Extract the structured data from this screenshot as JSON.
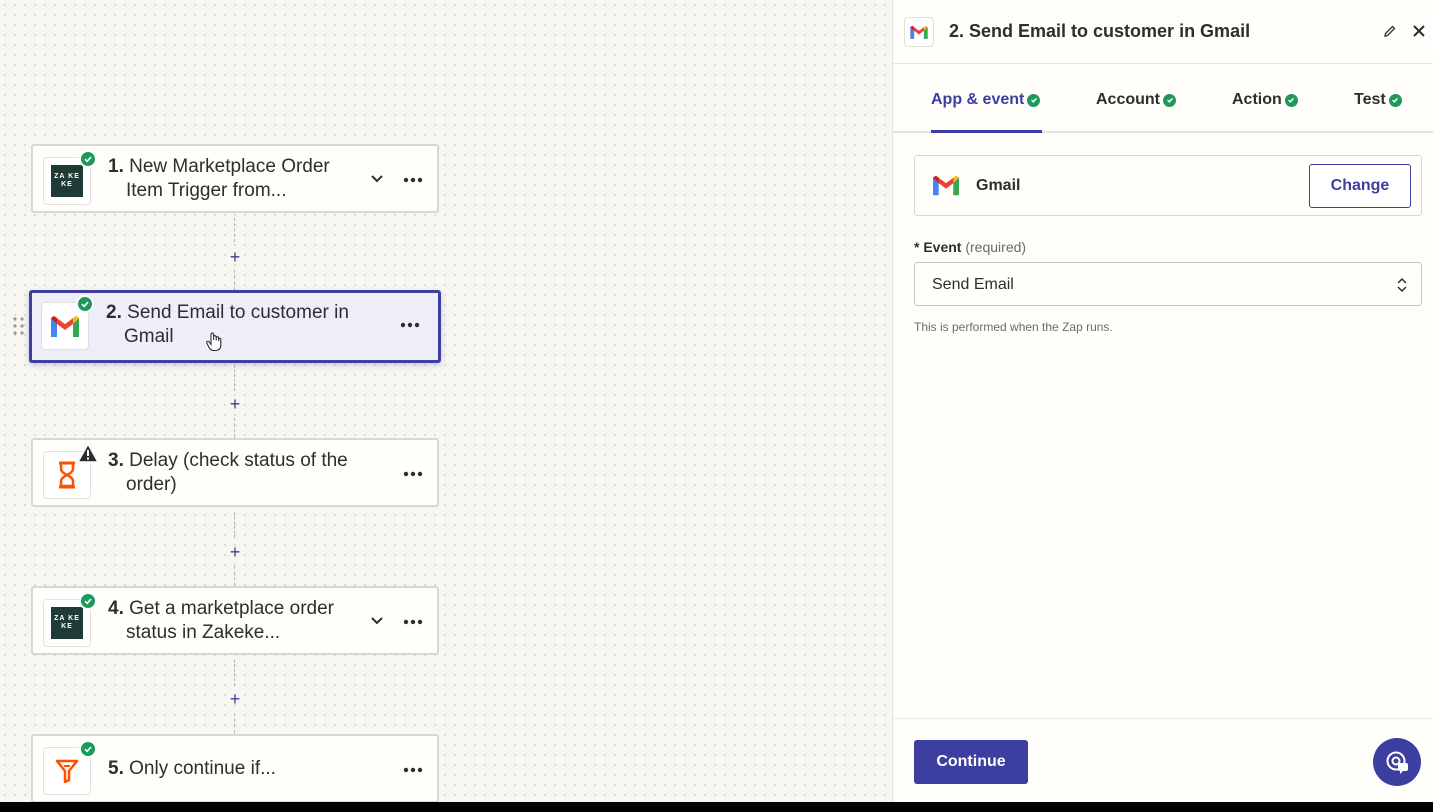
{
  "canvas": {
    "steps": [
      {
        "num": "1.",
        "line1": "New Marketplace Order",
        "line2": "Item Trigger from...",
        "icon": "zakeke-icon",
        "status": "ok"
      },
      {
        "num": "2.",
        "line1": "Send Email to customer in",
        "line2": "Gmail",
        "icon": "gmail-icon",
        "status": "ok"
      },
      {
        "num": "3.",
        "line1": "Delay (check status of the",
        "line2": "order)",
        "icon": "delay-hourglass-icon",
        "status": "warning"
      },
      {
        "num": "4.",
        "line1": "Get a marketplace order",
        "line2": "status in Zakeke...",
        "icon": "zakeke-icon",
        "status": "ok"
      },
      {
        "num": "5.",
        "line1": "Only continue if...",
        "line2": "",
        "icon": "filter-icon",
        "status": "ok"
      }
    ],
    "add_symbol": "+",
    "zakeke_logo_text": "ZA KE KE"
  },
  "panel": {
    "title": "2. Send Email to customer in Gmail",
    "tabs": [
      {
        "label": "App & event",
        "active": true
      },
      {
        "label": "Account",
        "active": false
      },
      {
        "label": "Action",
        "active": false
      },
      {
        "label": "Test",
        "active": false
      }
    ],
    "app": {
      "name": "Gmail",
      "change_label": "Change"
    },
    "event": {
      "required_marker": "*",
      "label": "Event",
      "required_text": "(required)",
      "value": "Send Email",
      "help": "This is performed when the Zap runs."
    },
    "continue_label": "Continue"
  },
  "colors": {
    "accent": "#3d3fa0",
    "success": "#1d9a5b",
    "selected_bg": "#edeef9",
    "canvas_bg": "#f7f6f1"
  }
}
